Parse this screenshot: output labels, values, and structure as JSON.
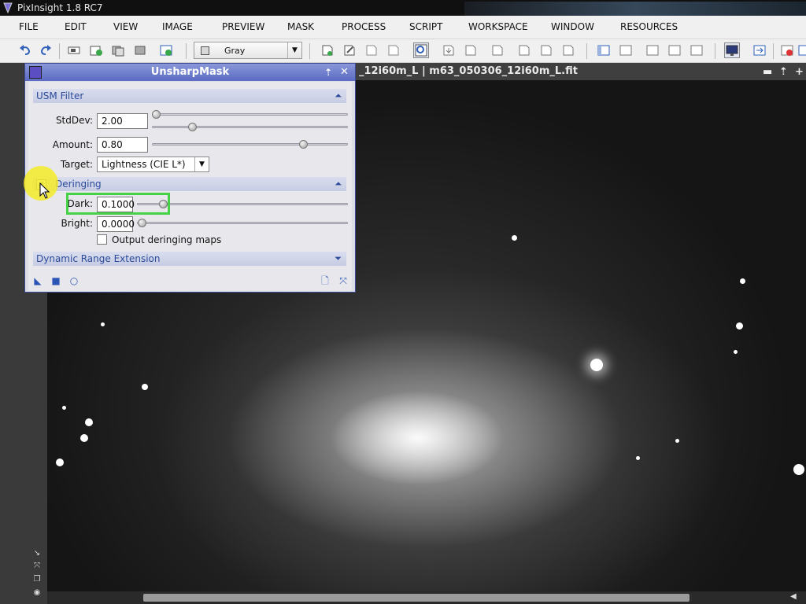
{
  "app": {
    "title": "PixInsight 1.8 RC7"
  },
  "menu": [
    "FILE",
    "EDIT",
    "VIEW",
    "IMAGE",
    "PREVIEW",
    "MASK",
    "PROCESS",
    "SCRIPT",
    "WORKSPACE",
    "WINDOW",
    "RESOURCES"
  ],
  "toolbar": {
    "color_mode": "Gray"
  },
  "image_window": {
    "title": "_12i60m_L | m63_050306_12i60m_L.fit"
  },
  "dialog": {
    "title": "UnsharpMask",
    "usm_section": "USM Filter",
    "stddev_label": "StdDev:",
    "stddev_value": "2.00",
    "amount_label": "Amount:",
    "amount_value": "0.80",
    "target_label": "Target:",
    "target_value": "Lightness (CIE L*)",
    "deringing_section": "Deringing",
    "deringing_checked": true,
    "dark_label": "Dark:",
    "dark_value": "0.1000",
    "bright_label": "Bright:",
    "bright_value": "0.0000",
    "output_maps_label": "Output deringing maps",
    "output_maps_checked": false,
    "dre_section": "Dynamic Range Extension"
  },
  "colors": {
    "dialog_title": "#5a6bc3",
    "section_text": "#2b4a9c",
    "highlight": "#46d246"
  }
}
